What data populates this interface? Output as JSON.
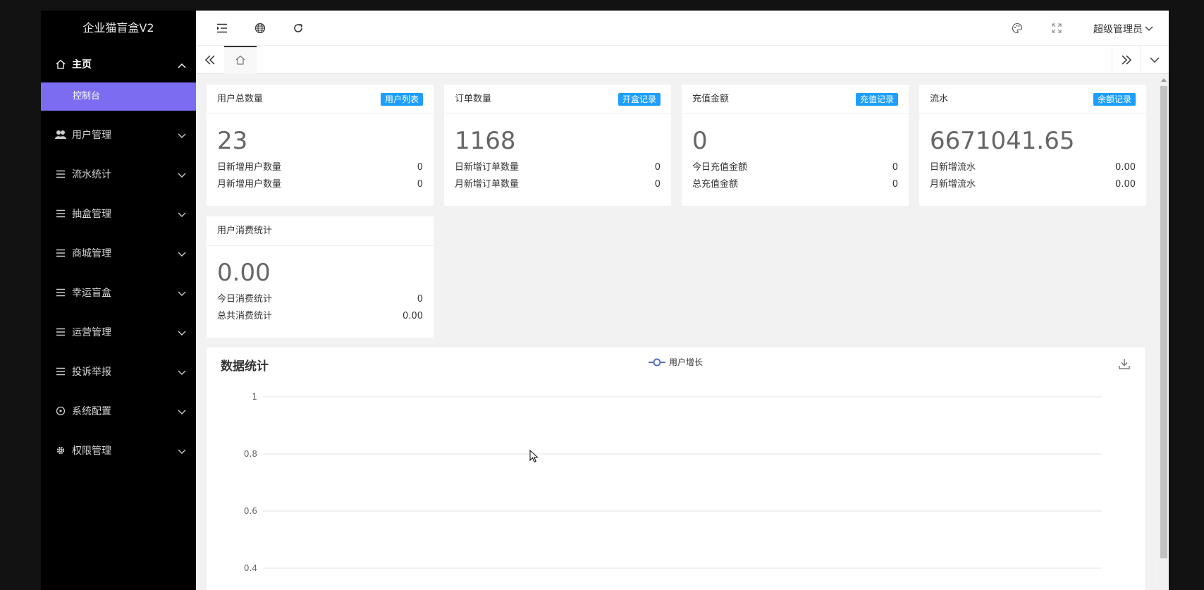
{
  "app": {
    "title": "企业猫盲盒V2"
  },
  "sidebar": {
    "items": [
      {
        "label": "主页",
        "icon": "home-icon",
        "expanded": true
      },
      {
        "label": "用户管理",
        "icon": "users-icon"
      },
      {
        "label": "流水统计",
        "icon": "list-icon"
      },
      {
        "label": "抽盒管理",
        "icon": "list-icon"
      },
      {
        "label": "商城管理",
        "icon": "list-icon"
      },
      {
        "label": "幸运盲盒",
        "icon": "list-icon"
      },
      {
        "label": "运营管理",
        "icon": "list-icon"
      },
      {
        "label": "投诉举报",
        "icon": "list-icon"
      },
      {
        "label": "系统配置",
        "icon": "settings-circle-icon"
      },
      {
        "label": "权限管理",
        "icon": "gear-icon"
      }
    ],
    "submenu": {
      "label": "控制台"
    }
  },
  "topbar": {
    "admin_label": "超级管理员"
  },
  "cards": [
    {
      "title": "用户总数量",
      "badge": "用户列表",
      "value": "23",
      "row1_label": "日新增用户数量",
      "row1_value": "0",
      "row2_label": "月新增用户数量",
      "row2_value": "0"
    },
    {
      "title": "订单数量",
      "badge": "开盒记录",
      "value": "1168",
      "row1_label": "日新增订单数量",
      "row1_value": "0",
      "row2_label": "月新增订单数量",
      "row2_value": "0"
    },
    {
      "title": "充值金额",
      "badge": "充值记录",
      "value": "0",
      "row1_label": "今日充值金额",
      "row1_value": "0",
      "row2_label": "总充值金额",
      "row2_value": "0"
    },
    {
      "title": "流水",
      "badge": "余额记录",
      "value": "6671041.65",
      "row1_label": "日新增流水",
      "row1_value": "0.00",
      "row2_label": "月新增流水",
      "row2_value": "0.00"
    },
    {
      "title": "用户消费统计",
      "badge": "",
      "value": "0.00",
      "row1_label": "今日消费统计",
      "row1_value": "0",
      "row2_label": "总共消费统计",
      "row2_value": "0.00"
    }
  ],
  "colors": {
    "accent": "#7c6cf2",
    "badge": "#1e9fff",
    "sidebar": "#000000"
  },
  "chart_data": {
    "type": "line",
    "title": "数据统计",
    "series": [
      {
        "name": "用户增长",
        "values": []
      }
    ],
    "yticks": [
      "1",
      "0.8",
      "0.6",
      "0.4"
    ],
    "ylim": [
      0.4,
      1
    ],
    "grid": true,
    "legend": "top-center"
  }
}
